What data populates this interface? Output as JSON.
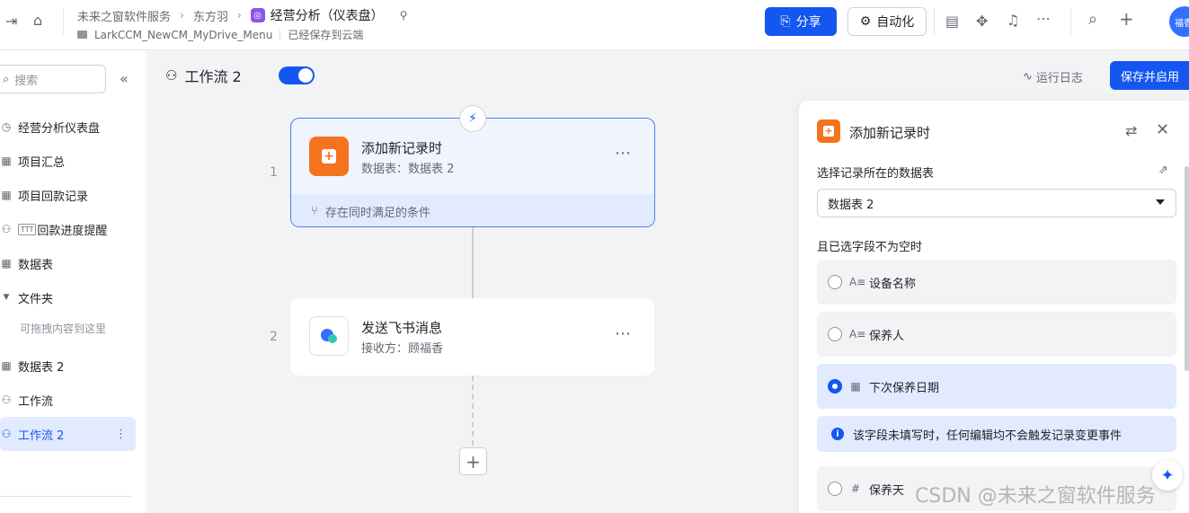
{
  "topbar": {
    "breadcrumb": [
      "未来之窗软件服务",
      "东方羽"
    ],
    "current_page": "经营分析（仪表盘）",
    "sub_path": "LarkCCM_NewCM_MyDrive_Menu",
    "save_status": "已经保存到云端",
    "share_label": "分享",
    "automation_label": "自动化",
    "avatar_text": "福香"
  },
  "sidebar": {
    "search_placeholder": "搜索",
    "items": [
      {
        "label": "经营分析仪表盘",
        "icon": "dashboard-icon"
      },
      {
        "label": "项目汇总",
        "icon": "table-icon"
      },
      {
        "label": "项目回款记录",
        "icon": "table-icon"
      },
      {
        "label": "回款进度提醒",
        "icon": "workflow-icon"
      },
      {
        "label": "数据表",
        "icon": "table-icon"
      },
      {
        "label": "文件夹",
        "icon": "folder-caret-icon"
      },
      {
        "label": "可拖拽内容到这里"
      },
      {
        "label": "数据表 2",
        "icon": "table-icon"
      },
      {
        "label": "工作流",
        "icon": "workflow-icon"
      },
      {
        "label": "工作流 2",
        "icon": "workflow-icon"
      }
    ]
  },
  "workflow": {
    "title": "工作流 2",
    "enabled": true,
    "run_log_label": "运行日志",
    "save_enable_label": "保存并启用",
    "steps": [
      {
        "number": "1",
        "title": "添加新记录时",
        "subtitle": "数据表：数据表 2",
        "condition": "存在同时满足的条件"
      },
      {
        "number": "2",
        "title": "发送飞书消息",
        "subtitle": "接收方：顾福香"
      }
    ]
  },
  "panel": {
    "title": "添加新记录时",
    "table_label": "选择记录所在的数据表",
    "table_value": "数据表 2",
    "fields_label": "且已选字段不为空时",
    "fields": [
      {
        "label": "设备名称",
        "type_icon": "A≡",
        "selected": false
      },
      {
        "label": "保养人",
        "type_icon": "A≡",
        "selected": false
      },
      {
        "label": "下次保养日期",
        "type_icon": "▦",
        "selected": true
      },
      {
        "label": "保养天",
        "type_icon": "#",
        "selected": false
      }
    ],
    "info_text": "该字段未填写时，任何编辑均不会触发记录变更事件"
  },
  "watermark": "CSDN @未来之窗软件服务",
  "colors": {
    "accent": "#1456f0",
    "trigger": "#f5731e",
    "canvas": "#f2f3f5"
  }
}
